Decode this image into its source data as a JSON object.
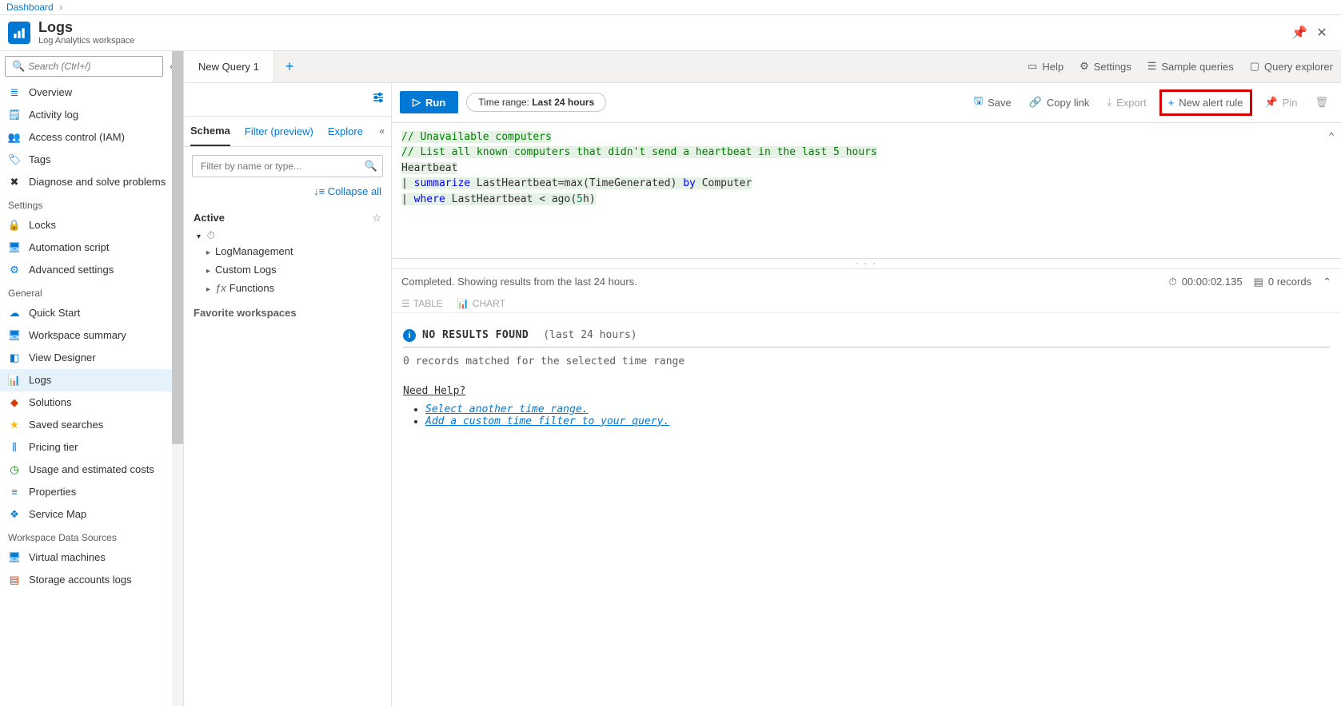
{
  "breadcrumb": {
    "item": "Dashboard"
  },
  "header": {
    "title": "Logs",
    "subtitle": "Log Analytics workspace"
  },
  "leftNav": {
    "searchPlaceholder": "Search (Ctrl+/)",
    "items1": [
      {
        "icon": "≣",
        "color": "#0078d4",
        "label": "Overview"
      },
      {
        "icon": "🗒",
        "color": "#0078d4",
        "label": "Activity log"
      },
      {
        "icon": "👥",
        "color": "#0078d4",
        "label": "Access control (IAM)"
      },
      {
        "icon": "🏷",
        "color": "#0078d4",
        "label": "Tags"
      },
      {
        "icon": "✖",
        "color": "#323130",
        "label": "Diagnose and solve problems"
      }
    ],
    "section2": "Settings",
    "items2": [
      {
        "icon": "🔒",
        "color": "#323130",
        "label": "Locks"
      },
      {
        "icon": "🖥",
        "color": "#0078d4",
        "label": "Automation script"
      },
      {
        "icon": "⚙",
        "color": "#0078d4",
        "label": "Advanced settings"
      }
    ],
    "section3": "General",
    "items3": [
      {
        "icon": "☁",
        "color": "#0078d4",
        "label": "Quick Start"
      },
      {
        "icon": "🖥",
        "color": "#0078d4",
        "label": "Workspace summary"
      },
      {
        "icon": "◧",
        "color": "#0078d4",
        "label": "View Designer"
      },
      {
        "icon": "📊",
        "color": "#0078d4",
        "label": "Logs",
        "active": true
      },
      {
        "icon": "◆",
        "color": "#d83b01",
        "label": "Solutions"
      },
      {
        "icon": "★",
        "color": "#ffb900",
        "label": "Saved searches"
      },
      {
        "icon": "⫼",
        "color": "#0078d4",
        "label": "Pricing tier"
      },
      {
        "icon": "◷",
        "color": "#107c10",
        "label": "Usage and estimated costs"
      },
      {
        "icon": "≡",
        "color": "#0078d4",
        "label": "Properties"
      },
      {
        "icon": "❖",
        "color": "#0078d4",
        "label": "Service Map"
      }
    ],
    "section4": "Workspace Data Sources",
    "items4": [
      {
        "icon": "🖥",
        "color": "#0078d4",
        "label": "Virtual machines"
      },
      {
        "icon": "▤",
        "color": "#d83b01",
        "label": "Storage accounts logs"
      }
    ]
  },
  "tabs": {
    "tab1": "New Query 1"
  },
  "topButtons": {
    "help": "Help",
    "settings": "Settings",
    "sample": "Sample queries",
    "explorer": "Query explorer"
  },
  "actionBar": {
    "run": "Run",
    "timeRangeLabel": "Time range:",
    "timeRangeValue": "Last 24 hours",
    "save": "Save",
    "copy": "Copy link",
    "export": "Export",
    "newAlert": "New alert rule",
    "pin": "Pin"
  },
  "schema": {
    "tabs": {
      "schema": "Schema",
      "filter": "Filter (preview)",
      "explore": "Explore"
    },
    "filterPlaceholder": "Filter by name or type...",
    "collapseAll": "Collapse all",
    "activeLabel": "Active",
    "tree": [
      "LogManagement",
      "Custom Logs",
      "Functions"
    ],
    "treeIcons": [
      "",
      "",
      "ƒx"
    ],
    "favLabel": "Favorite workspaces"
  },
  "query": {
    "l1": "// Unavailable computers",
    "l2": "// List all known computers that didn't send a heartbeat in the last 5 hours",
    "l3a": "Heartbeat",
    "l4": {
      "pipe": "| ",
      "kw": "summarize",
      "mid": " LastHeartbeat=max(TimeGenerated) ",
      "by": "by",
      "end": " Computer"
    },
    "l5": {
      "pipe": "| ",
      "kw": "where",
      "mid": " LastHeartbeat < ago(",
      "num": "5",
      "end": "h)"
    }
  },
  "results": {
    "status": "Completed. Showing results from the last 24 hours.",
    "duration": "00:00:02.135",
    "records": "0 records",
    "tableTab": "TABLE",
    "chartTab": "CHART",
    "noResults": "NO RESULTS FOUND",
    "noResultsRange": "(last 24 hours)",
    "sub": "0 records matched for the selected time range",
    "helpHdr": "Need Help?",
    "help1": "Select another time range.",
    "help2": "Add a custom time filter to your query."
  }
}
